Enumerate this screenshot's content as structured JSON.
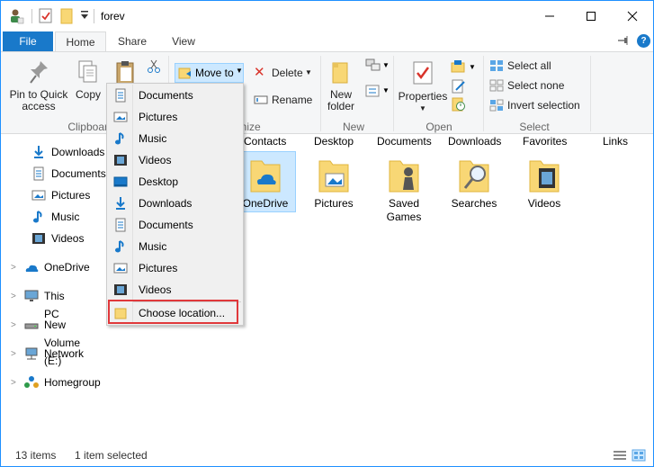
{
  "window": {
    "title": "forev",
    "controls": {
      "minimize": "—",
      "maximize": "☐",
      "close": "✕"
    }
  },
  "tabs": {
    "file": "File",
    "home": "Home",
    "share": "Share",
    "view": "View"
  },
  "ribbon": {
    "pin_to_quick_access": "Pin to Quick access",
    "copy": "Copy",
    "move_to": "Move to",
    "delete": "Delete",
    "rename": "Rename",
    "new_folder": "New folder",
    "properties": "Properties",
    "select_all": "Select all",
    "select_none": "Select none",
    "invert_selection": "Invert selection",
    "groups": {
      "clipboard": "Clipboard",
      "organize": "anize",
      "new": "New",
      "open": "Open",
      "select": "Select"
    }
  },
  "nav": {
    "quick_items": [
      "Downloads",
      "Documents",
      "Pictures",
      "Music",
      "Videos"
    ],
    "onedrive": "OneDrive",
    "this_pc": "This PC",
    "new_volume": "New Volume (E:)",
    "network": "Network",
    "homegroup": "Homegroup"
  },
  "content": {
    "top_row": [
      "Contacts",
      "Desktop",
      "Documents",
      "Downloads",
      "Favorites",
      "Links"
    ],
    "items": [
      {
        "label": "OneDrive",
        "icon": "onedrive-folder-icon"
      },
      {
        "label": "Pictures",
        "icon": "pictures-folder-icon"
      },
      {
        "label": "Saved Games",
        "icon": "saved-games-folder-icon"
      },
      {
        "label": "Searches",
        "icon": "searches-folder-icon"
      },
      {
        "label": "Videos",
        "icon": "videos-folder-icon"
      }
    ]
  },
  "move_menu": {
    "items": [
      "Documents",
      "Pictures",
      "Music",
      "Videos",
      "Desktop",
      "Downloads",
      "Documents",
      "Music",
      "Pictures",
      "Videos"
    ],
    "choose_location": "Choose location..."
  },
  "status": {
    "items_count": "13 items",
    "selected": "1 item selected"
  },
  "colors": {
    "accent": "#1979ca",
    "folder": "#f8d775",
    "highlight_box": "#e0383b"
  }
}
